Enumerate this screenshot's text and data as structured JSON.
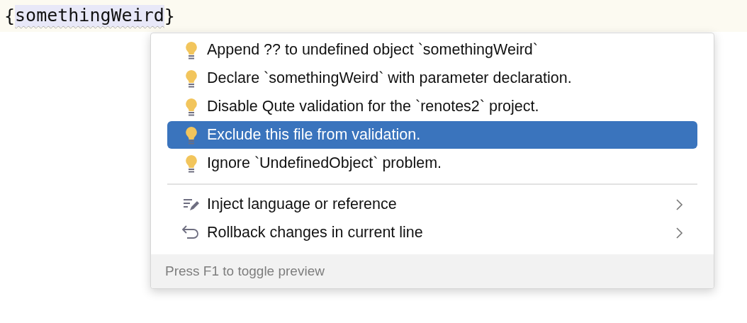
{
  "editor": {
    "line": {
      "prefix": "{",
      "identifier": "somethingWeird",
      "suffix": "}",
      "error": true
    }
  },
  "popup": {
    "groups": [
      {
        "items": [
          {
            "label": "Append ?? to undefined object `somethingWeird`",
            "kind": "bulb",
            "selected": false,
            "submenu": false
          },
          {
            "label": "Declare `somethingWeird` with parameter declaration.",
            "kind": "bulb",
            "selected": false,
            "submenu": false
          },
          {
            "label": "Disable Qute validation for the `renotes2` project.",
            "kind": "bulb",
            "selected": false,
            "submenu": false
          },
          {
            "label": "Exclude this file from validation.",
            "kind": "bulb",
            "selected": true,
            "submenu": false
          },
          {
            "label": "Ignore `UndefinedObject` problem.",
            "kind": "bulb",
            "selected": false,
            "submenu": false
          }
        ]
      },
      {
        "items": [
          {
            "label": "Inject language or reference",
            "kind": "edit",
            "selected": false,
            "submenu": true
          },
          {
            "label": "Rollback changes in current line",
            "kind": "undo",
            "selected": false,
            "submenu": true
          }
        ]
      }
    ],
    "footer": "Press F1 to toggle preview"
  }
}
